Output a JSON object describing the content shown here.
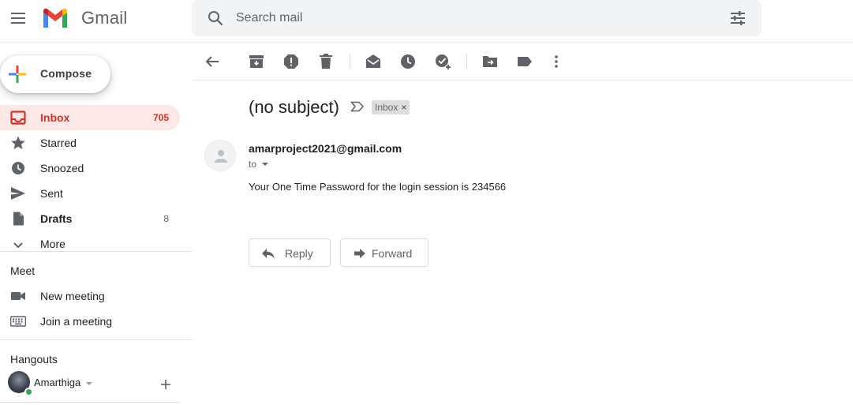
{
  "app": {
    "name": "Gmail"
  },
  "search": {
    "placeholder": "Search mail",
    "value": ""
  },
  "compose": {
    "label": "Compose"
  },
  "nav": {
    "items": [
      {
        "label": "Inbox",
        "count": "705",
        "icon": "inbox-icon",
        "active": true
      },
      {
        "label": "Starred",
        "count": "",
        "icon": "star-icon"
      },
      {
        "label": "Snoozed",
        "count": "",
        "icon": "clock-icon"
      },
      {
        "label": "Sent",
        "count": "",
        "icon": "send-icon"
      },
      {
        "label": "Drafts",
        "count": "8",
        "icon": "draft-icon"
      },
      {
        "label": "More",
        "count": "",
        "icon": "chevron-down-icon"
      }
    ]
  },
  "meet": {
    "title": "Meet",
    "items": [
      {
        "label": "New meeting",
        "icon": "videocam-icon"
      },
      {
        "label": "Join a meeting",
        "icon": "keyboard-icon"
      }
    ]
  },
  "hangouts": {
    "title": "Hangouts",
    "user": "Amarthiga"
  },
  "toolbar": {
    "icons": [
      "back-arrow-icon",
      "archive-icon",
      "report-spam-icon",
      "delete-icon",
      "mark-unread-icon",
      "snooze-icon",
      "add-to-tasks-icon",
      "move-to-icon",
      "label-icon",
      "more-vert-icon"
    ]
  },
  "message": {
    "subject": "(no subject)",
    "label_chip": "Inbox",
    "label_remove": "×",
    "from": "amarproject2021@gmail.com",
    "to": "to",
    "body": "Your One Time Password for the login session is 234566"
  },
  "actions": {
    "reply": "Reply",
    "forward": "Forward"
  },
  "colors": {
    "accent_red": "#d93025",
    "active_bg": "#fce8e6",
    "icon_gray": "#5f6368"
  }
}
